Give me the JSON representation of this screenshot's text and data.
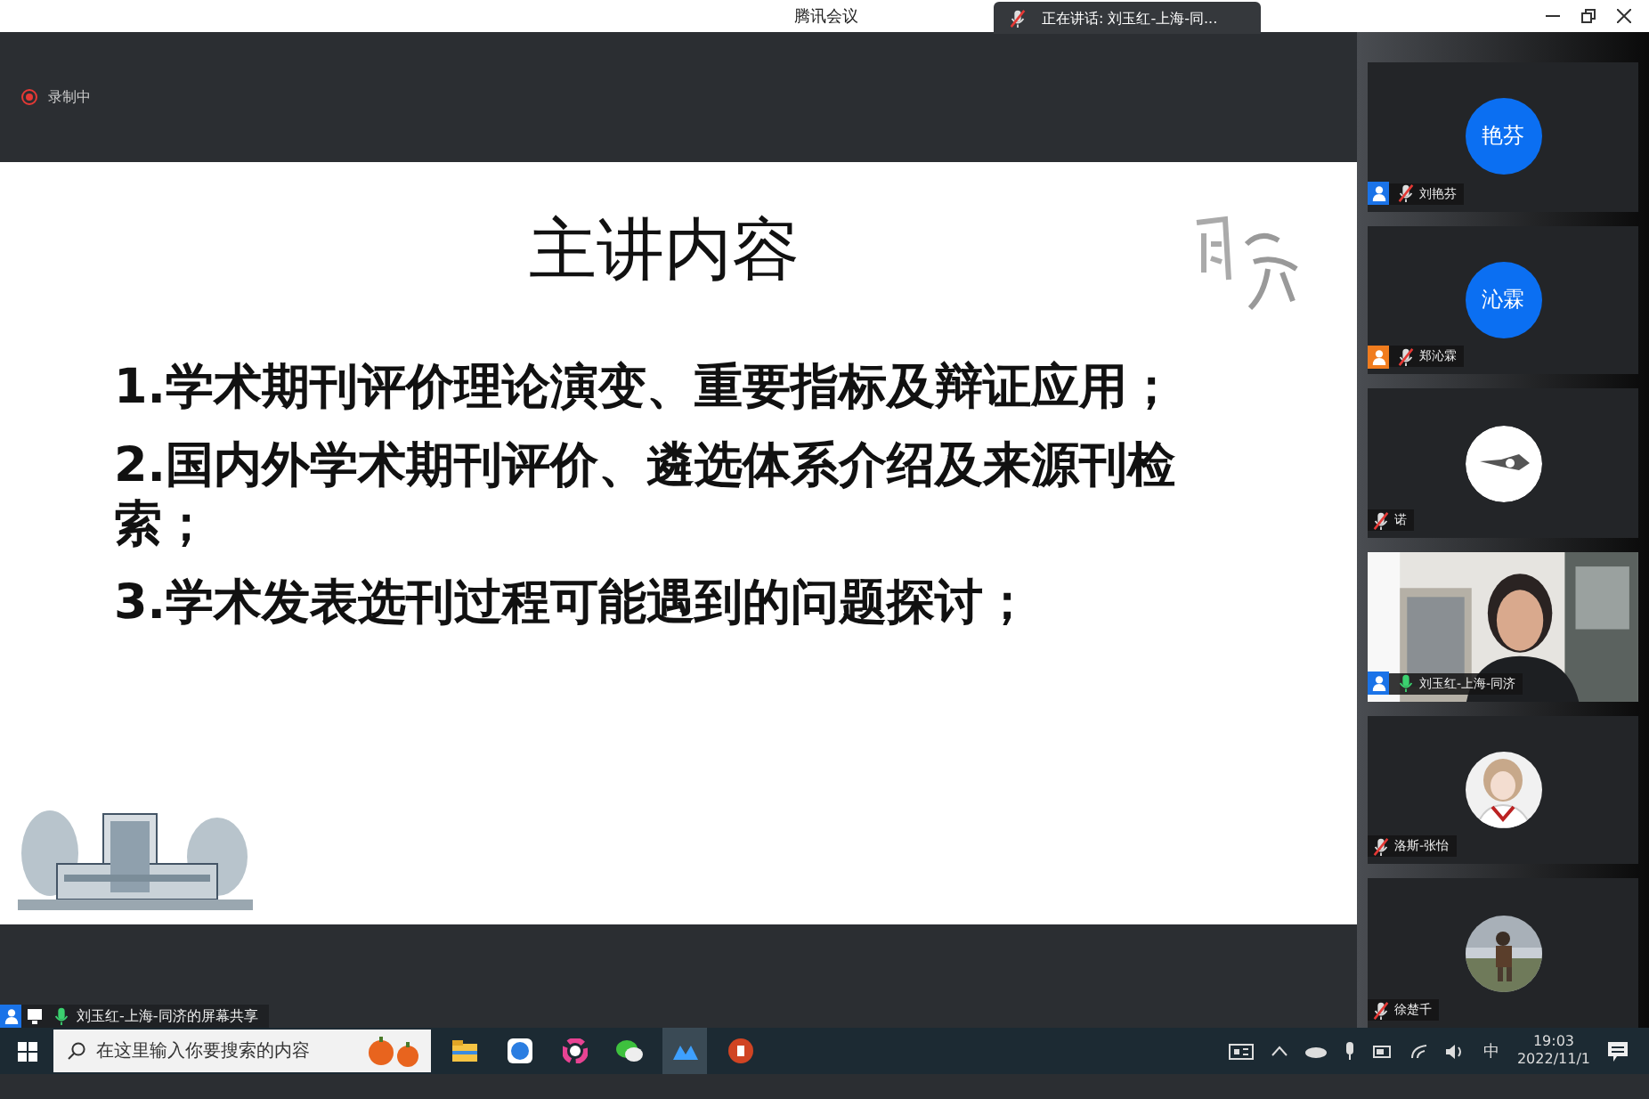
{
  "window": {
    "title": "腾讯会议"
  },
  "speaking_banner": {
    "text": "正在讲话: 刘玉红-上海-同...",
    "muted": true
  },
  "recording": {
    "label": "录制中"
  },
  "slide": {
    "title": "主讲内容",
    "items": [
      {
        "number": "1.",
        "text": "学术期刊评价理论演变、重要指标及辩证应用；"
      },
      {
        "number": "2.",
        "text": "国内外学术期刊评价、遴选体系介绍及来源刊检索；"
      },
      {
        "number": "3.",
        "text": "学术发表选刊过程可能遇到的问题探讨；"
      }
    ]
  },
  "participants": [
    {
      "kind": "initials",
      "initials": "艳芬",
      "name": "刘艳芬",
      "muted": true,
      "badge": {
        "color": "#1a73e8"
      }
    },
    {
      "kind": "initials",
      "initials": "沁霖",
      "name": "郑沁霖",
      "muted": true,
      "badge": {
        "color": "#f07c1e"
      }
    },
    {
      "kind": "logo",
      "name": "诺",
      "muted": true
    },
    {
      "kind": "video",
      "name": "刘玉红-上海-同济",
      "muted": false,
      "badge": {
        "color": "#1a73e8"
      }
    },
    {
      "kind": "avatar",
      "name": "洛斯-张怡",
      "muted": true
    },
    {
      "kind": "avatar",
      "name": "徐楚千",
      "muted": true
    }
  ],
  "share_bar": {
    "label": "刘玉红-上海-同济的屏幕共享",
    "muted": false
  },
  "taskbar": {
    "search": {
      "placeholder": "在这里输入你要搜索的内容"
    },
    "ime": "中",
    "time": "19:03",
    "date": "2022/11/1"
  }
}
